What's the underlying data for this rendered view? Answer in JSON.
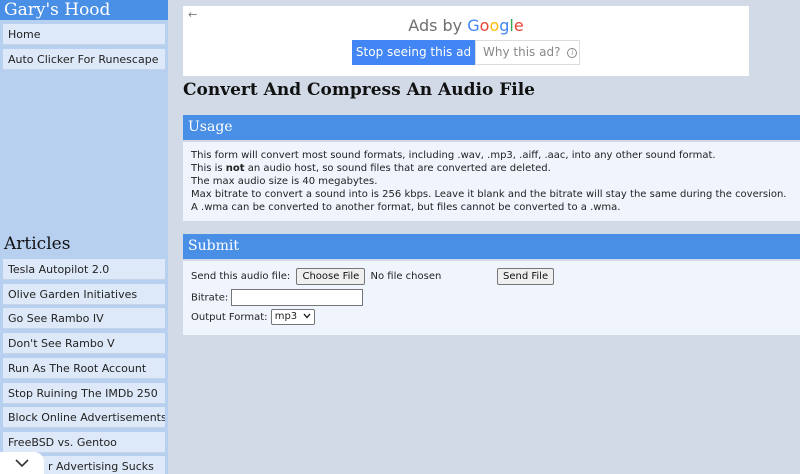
{
  "sidebar": {
    "site_title": "Gary's Hood",
    "nav": [
      {
        "label": "Home"
      },
      {
        "label": "Auto Clicker For Runescape"
      }
    ],
    "articles_title": "Articles",
    "articles": [
      {
        "label": "Tesla Autopilot 2.0"
      },
      {
        "label": "Olive Garden Initiatives"
      },
      {
        "label": "Go See Rambo IV"
      },
      {
        "label": "Don't See Rambo V"
      },
      {
        "label": "Run As The Root Account"
      },
      {
        "label": "Stop Ruining The IMDb 250"
      },
      {
        "label": "Block Online Advertisements"
      },
      {
        "label": "FreeBSD vs. Gentoo"
      },
      {
        "label": "r Advertising Sucks"
      }
    ]
  },
  "ad": {
    "back_arrow": "←",
    "ads_by": "Ads by",
    "google": [
      "G",
      "o",
      "o",
      "g",
      "l",
      "e"
    ],
    "stop_label": "Stop seeing this ad",
    "why_label": "Why this ad?",
    "info_glyph": "i"
  },
  "main": {
    "title": "Convert And Compress An Audio File",
    "usage": {
      "header": "Usage",
      "line1": "This form will convert most sound formats, including .wav, .mp3, .aiff, .aac, into any other sound format.",
      "line2_pre": "This is ",
      "line2_bold": "not",
      "line2_post": " an audio host, so sound files that are converted are deleted.",
      "line3": "The max audio size is 40 megabytes.",
      "line4": "Max bitrate to convert a sound into is 256 kbps. Leave it blank and the bitrate will stay the same during the coversion.",
      "line5": "A .wma can be converted to another format, but files cannot be converted to a .wma."
    },
    "submit": {
      "header": "Submit",
      "file_label": "Send this audio file:",
      "choose_label": "Choose File",
      "no_file": "No file chosen",
      "send_label": "Send File",
      "bitrate_label": "Bitrate:",
      "bitrate_value": "",
      "format_label": "Output Format:",
      "format_selected": "mp3"
    }
  }
}
